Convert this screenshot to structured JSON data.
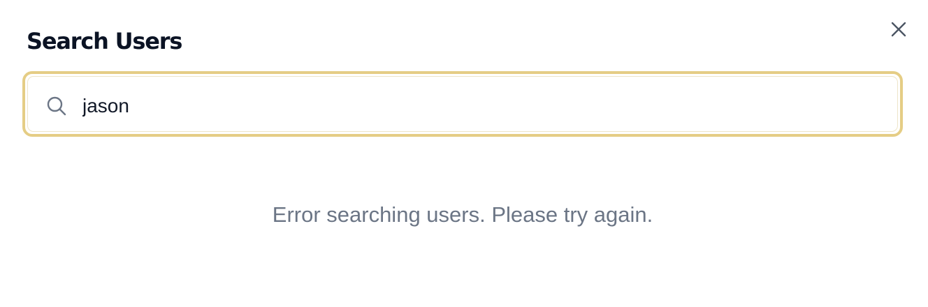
{
  "dialog": {
    "title": "Search Users",
    "close_icon": "close-icon"
  },
  "search": {
    "icon": "search-icon",
    "value": "jason",
    "placeholder": "",
    "focus_border_color": "#e5cd85"
  },
  "results": {
    "error_message": "Error searching users. Please try again.",
    "error_text_color": "#6b7585"
  }
}
